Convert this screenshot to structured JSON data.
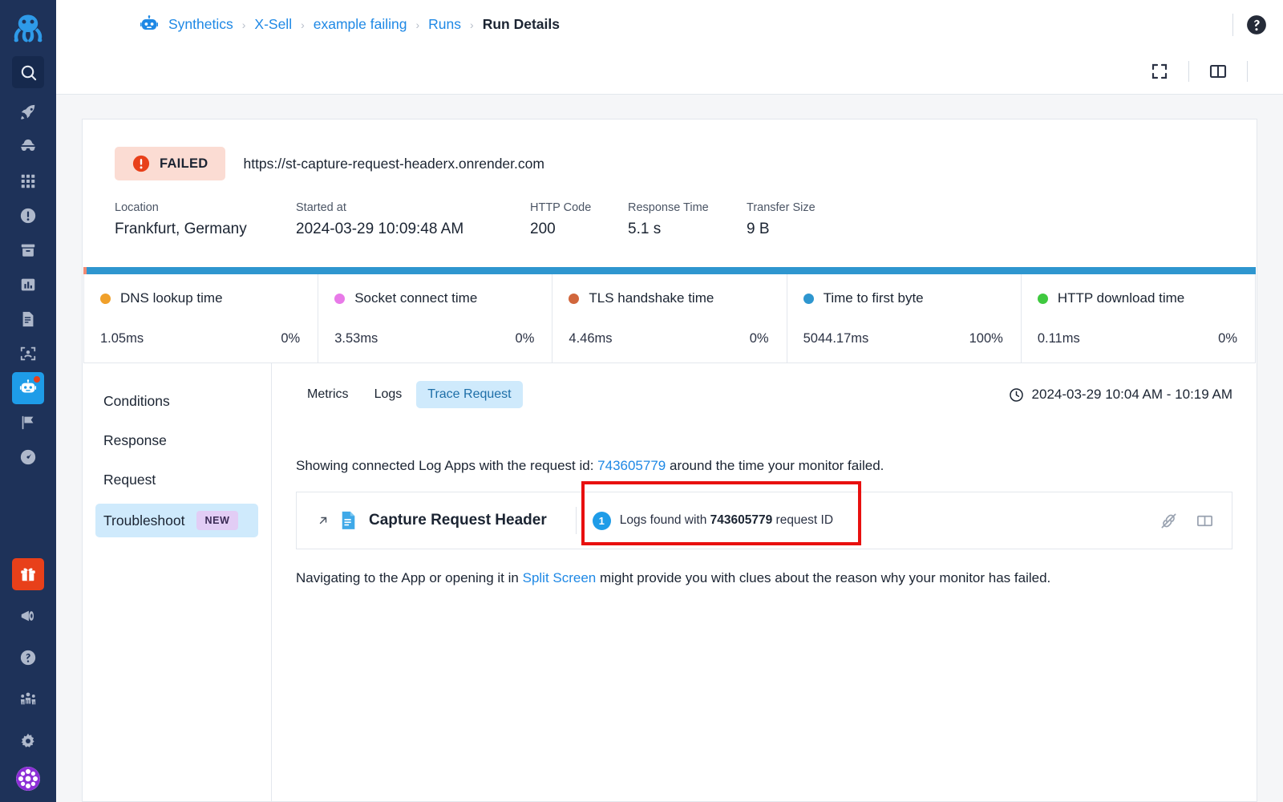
{
  "rail": {
    "logo": "octopus-logo",
    "items": [
      {
        "name": "search-icon",
        "label": "Search"
      },
      {
        "name": "rocket-icon",
        "label": "Deployments"
      },
      {
        "name": "detective-icon",
        "label": "Investigations"
      },
      {
        "name": "grid-icon",
        "label": "Apps"
      },
      {
        "name": "alert-circle-icon",
        "label": "Alerts"
      },
      {
        "name": "archive-icon",
        "label": "Archive"
      },
      {
        "name": "bar-chart-icon",
        "label": "Metrics"
      },
      {
        "name": "document-icon",
        "label": "Logs"
      },
      {
        "name": "scan-face-icon",
        "label": "RUM"
      },
      {
        "name": "robot-icon",
        "label": "Synthetics"
      },
      {
        "name": "flag-icon",
        "label": "Flags"
      },
      {
        "name": "gauge-icon",
        "label": "Performance"
      }
    ],
    "bottom_items": [
      {
        "name": "gift-icon",
        "label": "What's new"
      },
      {
        "name": "megaphone-icon",
        "label": "Announcements"
      },
      {
        "name": "help-circle-icon",
        "label": "Help"
      },
      {
        "name": "team-icon",
        "label": "Team"
      },
      {
        "name": "gear-icon",
        "label": "Settings"
      },
      {
        "name": "avatar",
        "label": "Account"
      }
    ]
  },
  "breadcrumb": {
    "app_icon": "robot-icon",
    "items": [
      {
        "label": "Synthetics",
        "link": true
      },
      {
        "label": "X-Sell",
        "link": true
      },
      {
        "label": "example failing",
        "link": true
      },
      {
        "label": "Runs",
        "link": true
      },
      {
        "label": "Run Details",
        "link": false
      }
    ],
    "separator": "›"
  },
  "topbar": {
    "help_icon": "help-circle-icon"
  },
  "toolbar": {
    "fullscreen_icon": "fullscreen-expand-icon",
    "split_icon": "split-panel-icon"
  },
  "summary": {
    "status": "FAILED",
    "status_icon": "error-circle-icon",
    "status_bg": "#fbdcd3",
    "status_icon_color": "#e8401a",
    "url": "https://st-capture-request-headerx.onrender.com",
    "facts": [
      {
        "label": "Location",
        "value": "Frankfurt, Germany"
      },
      {
        "label": "Started at",
        "value": "2024-03-29 10:09:48 AM"
      },
      {
        "label": "HTTP Code",
        "value": "200"
      },
      {
        "label": "Response Time",
        "value": "5.1 s"
      },
      {
        "label": "Transfer Size",
        "value": "9 B"
      }
    ]
  },
  "chart_data": {
    "type": "bar",
    "title": "Request timing breakdown",
    "categories": [
      "DNS lookup time",
      "Socket connect time",
      "TLS handshake time",
      "Time to first byte",
      "HTTP download time"
    ],
    "values": [
      1.05,
      3.53,
      4.46,
      5044.17,
      0.11
    ],
    "value_labels": [
      "1.05ms",
      "3.53ms",
      "4.46ms",
      "5044.17ms",
      "0.11ms"
    ],
    "percent_labels": [
      "0%",
      "0%",
      "0%",
      "100%",
      "0%"
    ],
    "percentages": [
      0,
      0,
      0,
      100,
      0
    ],
    "colors": [
      "#f0a02a",
      "#e87ae8",
      "#d1663c",
      "#2e96cf",
      "#3fc93f"
    ],
    "ylabel": "milliseconds",
    "xlabel": "",
    "legend_position": "inline",
    "accent_bar": {
      "lead_color": "#f08a73",
      "lead_width_pct": 0.3,
      "main_color": "#2e96cf"
    }
  },
  "subnav": {
    "items": [
      {
        "label": "Conditions",
        "selected": false,
        "badge": null
      },
      {
        "label": "Response",
        "selected": false,
        "badge": null
      },
      {
        "label": "Request",
        "selected": false,
        "badge": null
      },
      {
        "label": "Troubleshoot",
        "selected": true,
        "badge": "NEW"
      }
    ]
  },
  "pane": {
    "tabs": [
      {
        "label": "Metrics",
        "active": false
      },
      {
        "label": "Logs",
        "active": false
      },
      {
        "label": "Trace Request",
        "active": true
      }
    ],
    "time_range": "2024-03-29 10:04 AM - 10:19 AM",
    "clock_icon": "clock-icon",
    "lead_before": "Showing connected Log Apps with the request id:",
    "lead_request_id": "743605779",
    "lead_after": "around the time your monitor failed.",
    "app_card": {
      "open_icon": "arrow-up-right-icon",
      "doc_icon": "document-icon",
      "title": "Capture Request Header",
      "count": "1",
      "logs_text_before": "Logs found with",
      "logs_request_id": "743605779",
      "logs_text_after": "request ID",
      "unlink_icon": "broken-link-icon",
      "split_icon": "split-panel-icon",
      "highlight_color": "#e8100f"
    },
    "tail_before": "Navigating to the App or opening it in",
    "tail_link": "Split Screen",
    "tail_after": "might provide you with clues about the reason why your monitor has failed."
  }
}
